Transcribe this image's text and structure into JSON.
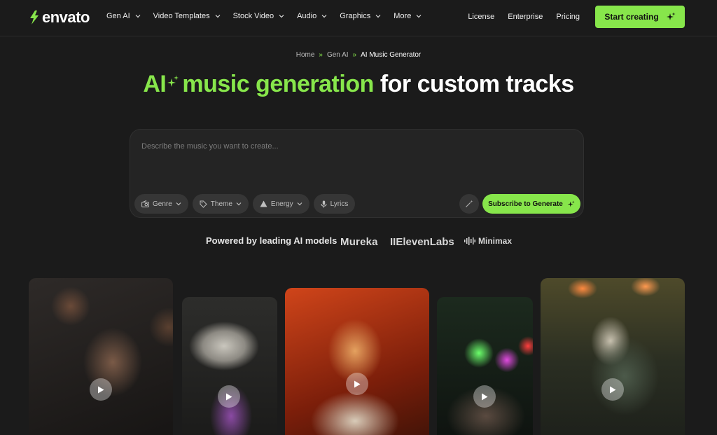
{
  "brand": {
    "name": "envato",
    "accent": "#87e64b"
  },
  "nav": {
    "items": [
      {
        "label": "Gen AI"
      },
      {
        "label": "Video Templates"
      },
      {
        "label": "Stock Video"
      },
      {
        "label": "Audio"
      },
      {
        "label": "Graphics"
      },
      {
        "label": "More"
      }
    ],
    "links": [
      {
        "label": "License"
      },
      {
        "label": "Enterprise"
      },
      {
        "label": "Pricing"
      }
    ],
    "cta": {
      "label": "Start creating",
      "icon": "sparkle-icon"
    }
  },
  "breadcrumb": {
    "items": [
      {
        "label": "Home"
      },
      {
        "label": "Gen AI"
      },
      {
        "label": "AI Music Generator"
      }
    ],
    "separator": "»"
  },
  "hero": {
    "title_green_1": "AI",
    "title_green_2": "music generation",
    "title_white": "for custom tracks"
  },
  "prompt": {
    "placeholder": "Describe the music you want to create...",
    "value": "",
    "chips": [
      {
        "label": "Genre",
        "icon": "radio-icon"
      },
      {
        "label": "Theme",
        "icon": "tag-icon"
      },
      {
        "label": "Energy",
        "icon": "triangle-icon"
      },
      {
        "label": "Lyrics",
        "icon": "microphone-icon"
      }
    ],
    "magic_icon": "magic-wand-icon",
    "generate_label": "Subscribe to Generate"
  },
  "powered": {
    "label": "Powered by leading AI models",
    "models": [
      "Mureka",
      "IIElevenLabs",
      "Minimax"
    ]
  },
  "cards": [
    {
      "name": "rapper-with-microphone",
      "icon": "play-icon"
    },
    {
      "name": "person-with-boombox",
      "icon": "play-icon"
    },
    {
      "name": "dj-in-orange-light",
      "icon": "play-icon"
    },
    {
      "name": "crowd-at-concert",
      "icon": "play-icon"
    },
    {
      "name": "rock-singer-on-stage",
      "icon": "play-icon"
    }
  ]
}
